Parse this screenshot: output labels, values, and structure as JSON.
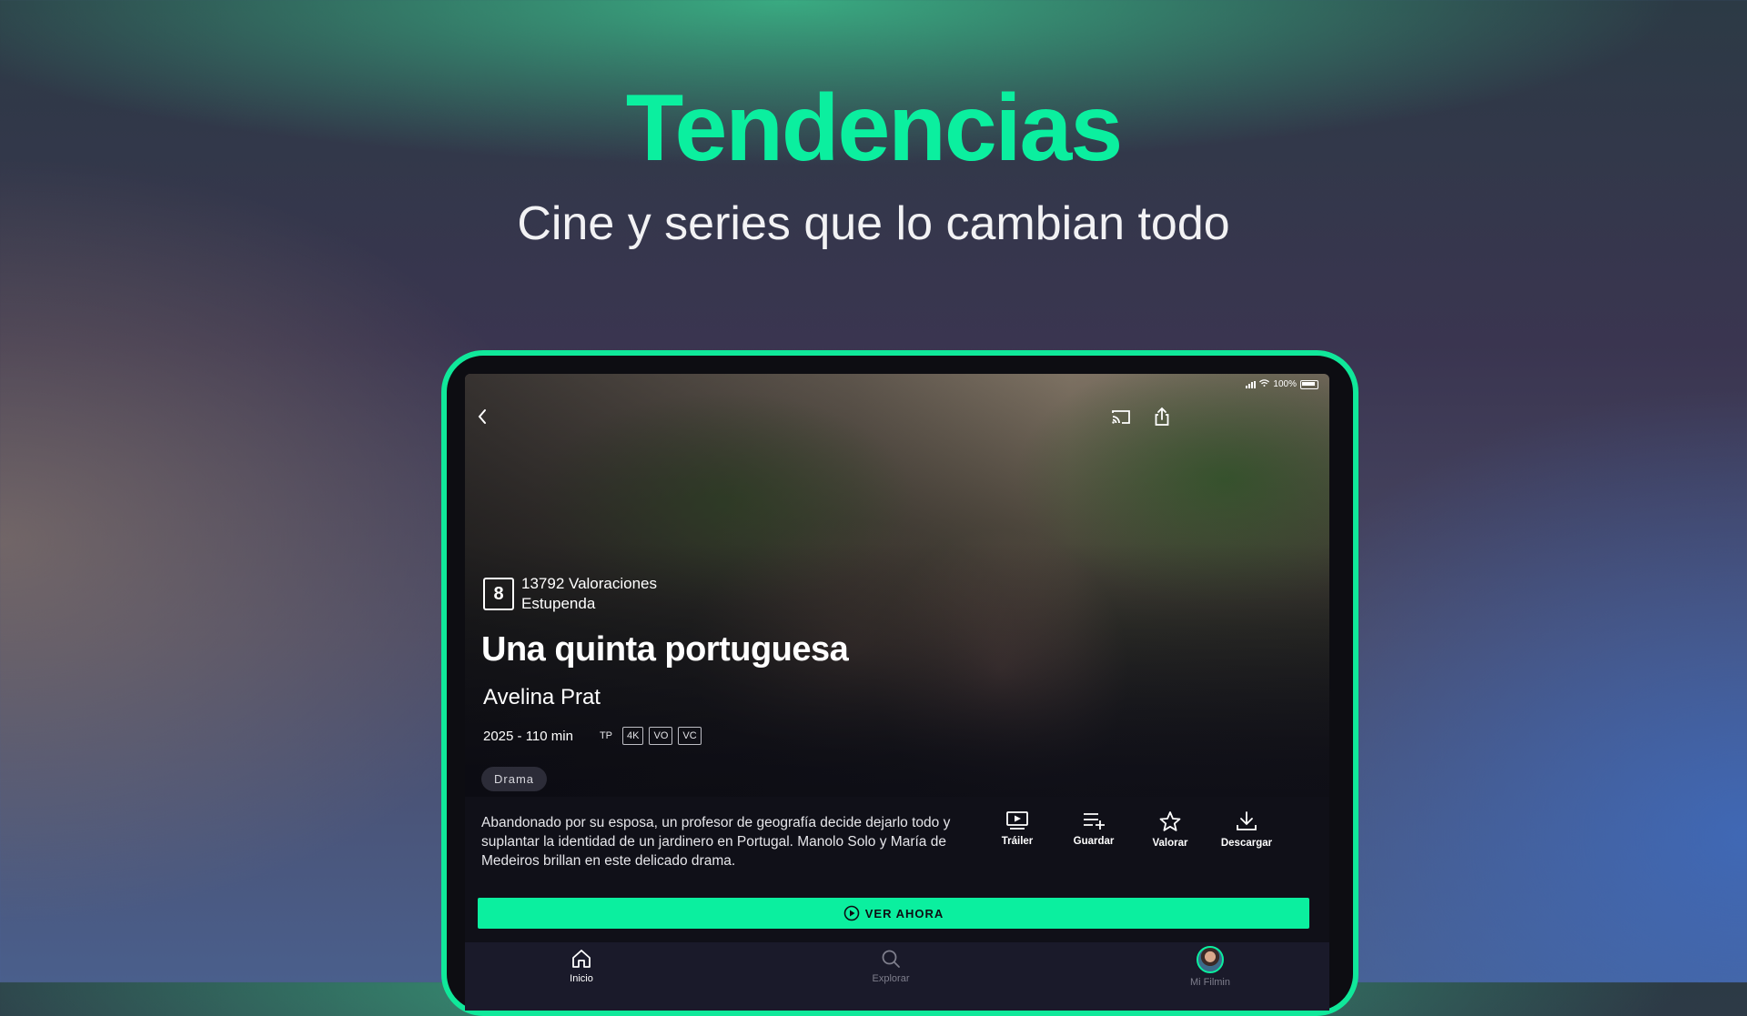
{
  "headline": "Tendencias",
  "subheadline": "Cine y series que lo cambian todo",
  "status_bar": {
    "battery": "100%"
  },
  "movie": {
    "score": "8",
    "ratings_count": "13792 Valoraciones",
    "rating_label": "Estupenda",
    "title": "Una quinta portuguesa",
    "director": "Avelina Prat",
    "year_duration": "2025 - 110 min",
    "badges": [
      "TP",
      "4K",
      "VO",
      "VC"
    ],
    "genre": "Drama",
    "synopsis": "Abandonado por su esposa, un profesor de geografía decide dejarlo todo y suplantar la identidad de un jardinero en Portugal. Manolo Solo y María de Medeiros brillan en este delicado drama."
  },
  "actions": {
    "trailer": "Tráiler",
    "save": "Guardar",
    "rate": "Valorar",
    "download": "Descargar"
  },
  "watch_button": "VER AHORA",
  "tabs": {
    "home": "Inicio",
    "explore": "Explorar",
    "profile": "Mi Filmin"
  },
  "colors": {
    "accent": "#0bef9f",
    "tabbar": "#1a1a2a"
  }
}
